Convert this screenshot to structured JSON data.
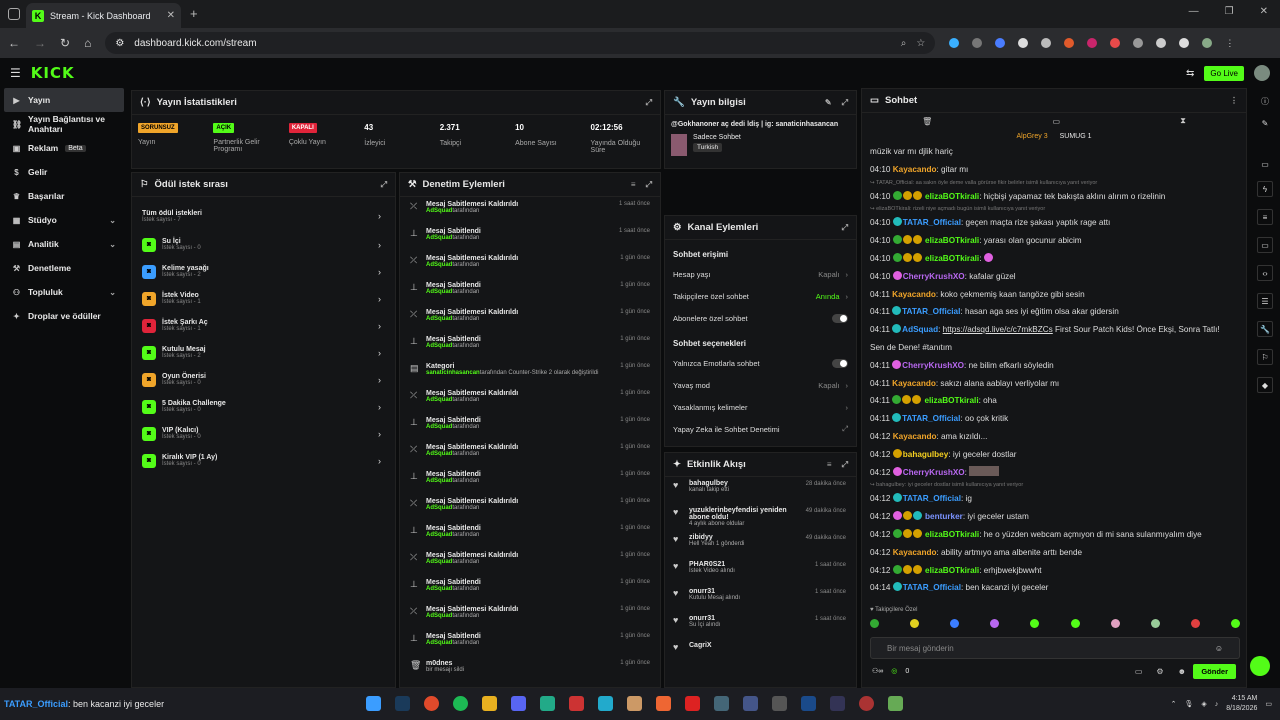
{
  "browser": {
    "tab_title": "Stream - Kick Dashboard",
    "url": "dashboard.kick.com/stream"
  },
  "header": {
    "logo": "KICK",
    "go_live": "Go Live"
  },
  "sidebar": {
    "items": [
      {
        "label": "Yayın",
        "icon": "video-icon",
        "active": true
      },
      {
        "label": "Yayın Bağlantısı ve Anahtarı",
        "icon": "link-icon"
      },
      {
        "label": "Reklam",
        "icon": "ad-icon",
        "badge": "Beta"
      },
      {
        "label": "Gelir",
        "icon": "dollar-icon"
      },
      {
        "label": "Başarılar",
        "icon": "trophy-icon"
      },
      {
        "label": "Stüdyo",
        "icon": "studio-icon",
        "expand": true
      },
      {
        "label": "Analitik",
        "icon": "chart-icon",
        "expand": true
      },
      {
        "label": "Denetleme",
        "icon": "hammer-icon"
      },
      {
        "label": "Topluluk",
        "icon": "community-icon",
        "expand": true
      },
      {
        "label": "Droplar ve ödüller",
        "icon": "gift-icon"
      }
    ]
  },
  "stats": {
    "title": "Yayın İstatistikleri",
    "items": [
      {
        "value": "SORUNSUZ",
        "label": "Yayın",
        "tag": "#f0a52a"
      },
      {
        "value": "AÇIK",
        "label": "Partnerlik Gelir Programı",
        "tag": "#53fc18"
      },
      {
        "value": "KAPALI",
        "label": "Çoklu Yayın",
        "tag": "#e0243a"
      },
      {
        "value": "43",
        "label": "İzleyici"
      },
      {
        "value": "2.371",
        "label": "Takipçi"
      },
      {
        "value": "10",
        "label": "Abone Sayısı"
      },
      {
        "value": "02:12:56",
        "label": "Yayında Olduğu Süre"
      }
    ]
  },
  "info": {
    "title": "Yayın bilgisi",
    "stream_title": "@Gokhanoner aç dedi ldiş | ig: sanaticinhasancan",
    "category": "Sadece Sohbet",
    "tag": "Turkish"
  },
  "rewards": {
    "title": "Ödül istek sırası",
    "all": "Tüm ödül istekleri",
    "all_count": "İstek sayısı - 7",
    "items": [
      {
        "name": "Su İçi",
        "count": "İstek sayısı - 0",
        "color": "#53fc18"
      },
      {
        "name": "Kelime yasağı",
        "count": "İstek sayısı - 2",
        "color": "#3b9dff"
      },
      {
        "name": "İstek Video",
        "count": "İstek sayısı - 1",
        "color": "#f0a52a"
      },
      {
        "name": "İstek Şarkı Aç",
        "count": "İstek sayısı - 1",
        "color": "#e0243a"
      },
      {
        "name": "Kutulu Mesaj",
        "count": "İstek sayısı - 2",
        "color": "#53fc18"
      },
      {
        "name": "Oyun Önerisi",
        "count": "İstek sayısı - 0",
        "color": "#f0a52a"
      },
      {
        "name": "5 Dakika Challenge",
        "count": "İstek sayısı - 0",
        "color": "#53fc18"
      },
      {
        "name": "VIP (Kalıcı)",
        "count": "İstek sayısı - 0",
        "color": "#53fc18"
      },
      {
        "name": "Kiralık VIP (1 Ay)",
        "count": "İstek sayısı - 0",
        "color": "#53fc18"
      }
    ]
  },
  "moderation": {
    "title": "Denetim Eylemleri",
    "items": [
      {
        "title": "Mesaj Sabitlemesi Kaldırıldı",
        "by": "AdSquad",
        "time": "1 saat önce"
      },
      {
        "title": "Mesaj Sabitlendi",
        "by": "AdSquad",
        "time": "1 saat önce"
      },
      {
        "title": "Mesaj Sabitlemesi Kaldırıldı",
        "by": "AdSquad",
        "time": "1 gün önce"
      },
      {
        "title": "Mesaj Sabitlendi",
        "by": "AdSquad",
        "time": "1 gün önce"
      },
      {
        "title": "Mesaj Sabitlemesi Kaldırıldı",
        "by": "AdSquad",
        "time": "1 gün önce"
      },
      {
        "title": "Mesaj Sabitlendi",
        "by": "AdSquad",
        "time": "1 gün önce"
      },
      {
        "title": "Kategori",
        "by": "sanaticinhasancan",
        "time": "1 gün önce"
      },
      {
        "title": "Mesaj Sabitlemesi Kaldırıldı",
        "by": "AdSquad",
        "time": "1 gün önce"
      },
      {
        "title": "Mesaj Sabitlendi",
        "by": "AdSquad",
        "time": "1 gün önce"
      },
      {
        "title": "Mesaj Sabitlemesi Kaldırıldı",
        "by": "AdSquad",
        "time": "1 gün önce"
      },
      {
        "title": "Mesaj Sabitlendi",
        "by": "AdSquad",
        "time": "1 gün önce"
      },
      {
        "title": "Mesaj Sabitlemesi Kaldırıldı",
        "by": "AdSquad",
        "time": "1 gün önce"
      },
      {
        "title": "Mesaj Sabitlendi",
        "by": "AdSquad",
        "time": "1 gün önce"
      },
      {
        "title": "Mesaj Sabitlemesi Kaldırıldı",
        "by": "AdSquad",
        "time": "1 gün önce"
      },
      {
        "title": "Mesaj Sabitlendi",
        "by": "AdSquad",
        "time": "1 gün önce"
      },
      {
        "title": "Mesaj Sabitlemesi Kaldırıldı",
        "by": "AdSquad",
        "time": "1 gün önce"
      },
      {
        "title": "Mesaj Sabitlendi",
        "by": "AdSquad",
        "time": "1 gün önce"
      },
      {
        "title": "m0dnes",
        "by": "",
        "time": "1 gün önce"
      }
    ],
    "suffix": "tarafından",
    "cat_rest": "tarafından Counter-Strike 2 olarak değiştirildi",
    "deleted": "bir mesajı sildi"
  },
  "channel": {
    "title": "Kanal Eylemleri",
    "chat_access": "Sohbet erişimi",
    "rows": [
      {
        "label": "Hesap yaşı",
        "value": "Kapalı",
        "type": "arrow"
      },
      {
        "label": "Takipçilere özel sohbet",
        "value": "Anında",
        "type": "arrow",
        "green": true
      },
      {
        "label": "Abonelere özel sohbet",
        "value": "",
        "type": "toggle"
      }
    ],
    "chat_options": "Sohbet seçenekleri",
    "rows2": [
      {
        "label": "Yalnızca Emotlarla sohbet",
        "value": "",
        "type": "toggle"
      },
      {
        "label": "Yavaş mod",
        "value": "Kapalı",
        "type": "arrow"
      },
      {
        "label": "Yasaklanmış kelimeler",
        "value": "",
        "type": "arrow"
      },
      {
        "label": "Yapay Zeka ile Sohbet Denetimi",
        "value": "",
        "type": "ext"
      }
    ]
  },
  "activity": {
    "title": "Etkinlik Akışı",
    "items": [
      {
        "user": "bahagulbey",
        "desc": "kanalı takip etti",
        "time": "28 dakika önce"
      },
      {
        "user": "yuzuklerinbeyfendisi yeniden abone oldu!",
        "desc": "4 aylık abone oldular",
        "time": "49 dakika önce"
      },
      {
        "user": "zibidyy",
        "desc": "Hell Yeah  1 gönderdi",
        "time": "49 dakika önce"
      },
      {
        "user": "PHAR0S21",
        "desc": "İstek Video alındı",
        "time": "1 saat önce"
      },
      {
        "user": "onurr31",
        "desc": "Kutulu Mesaj alındı",
        "time": "1 saat önce"
      },
      {
        "user": "onurr31",
        "desc": "Su İçi alındı",
        "time": "1 saat önce"
      },
      {
        "user": "CagriX",
        "desc": "",
        "time": ""
      }
    ]
  },
  "chat": {
    "title": "Sohbet",
    "top_users": [
      "AlpGrey 3",
      "SUMUG 1"
    ],
    "followers_only": "Takipçilere Özel",
    "placeholder": "Bir mesaj gönderin",
    "send": "Gönder",
    "points": "0"
  },
  "taskbar": {
    "ticker_user": "TATAR_Official",
    "ticker_msg": ": ben kacanzi iyi geceler",
    "time": "4:15 AM",
    "date": "8/18/2026"
  }
}
